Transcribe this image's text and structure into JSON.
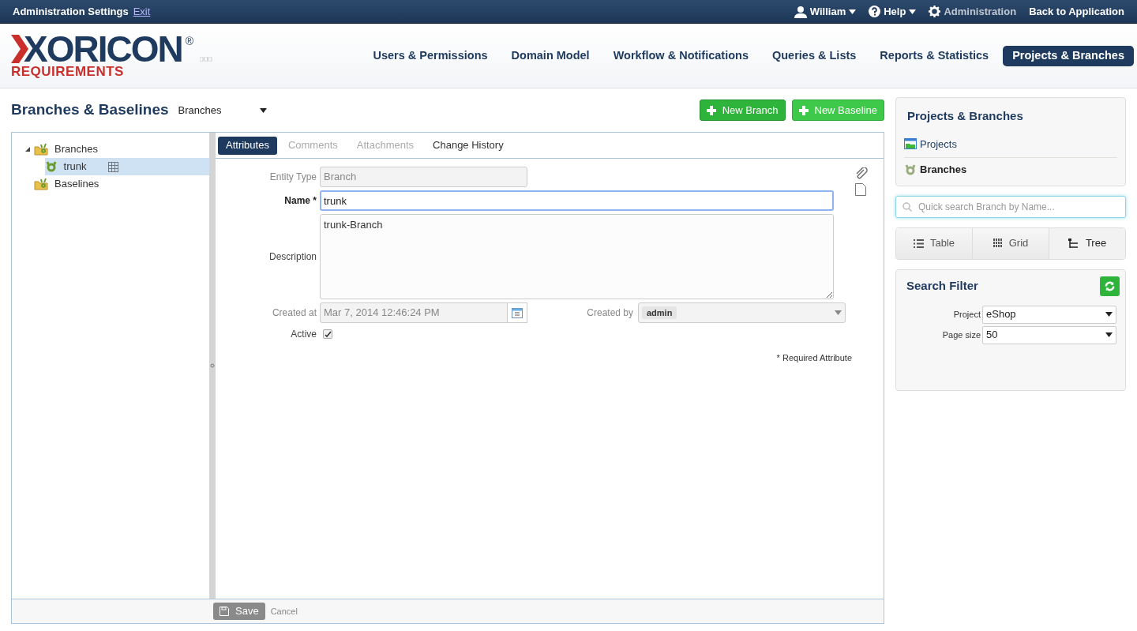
{
  "top_bar": {
    "title": "Administration Settings",
    "exit_link": "Exit",
    "user_menu": "William",
    "help_menu": "Help",
    "admin_label": "Administration",
    "back_link": "Back to Application"
  },
  "logo": {
    "name": "XORICON",
    "mark": "®",
    "subtitle": "REQUIREMENTS"
  },
  "main_nav": [
    {
      "label": "Users & Permissions",
      "selected": false
    },
    {
      "label": "Domain Model",
      "selected": false
    },
    {
      "label": "Workflow & Notifications",
      "selected": false
    },
    {
      "label": "Queries & Lists",
      "selected": false
    },
    {
      "label": "Reports & Statistics",
      "selected": false
    },
    {
      "label": "Projects & Branches",
      "selected": true
    }
  ],
  "page": {
    "title": "Branches & Baselines",
    "type_select": "Branches",
    "new_branch_button": "New Branch",
    "new_baseline_button": "New Baseline"
  },
  "tree": [
    {
      "label": "Branches",
      "kind": "folder",
      "expanded": true,
      "selected": false,
      "children": [
        {
          "label": "trunk",
          "kind": "branch",
          "selected": true
        }
      ]
    },
    {
      "label": "Baselines",
      "kind": "folder",
      "selected": false
    }
  ],
  "detail_tabs": [
    {
      "label": "Attributes",
      "selected": true,
      "disabled": false
    },
    {
      "label": "Comments",
      "selected": false,
      "disabled": true
    },
    {
      "label": "Attachments",
      "selected": false,
      "disabled": true
    },
    {
      "label": "Change History",
      "selected": false,
      "disabled": false
    }
  ],
  "form": {
    "entity_type_label": "Entity Type",
    "entity_type_value": "Branch",
    "name_label": "Name",
    "required_mark": "*",
    "name_value": "trunk",
    "description_label": "Description",
    "description_value": "trunk-Branch",
    "created_at_label": "Created at",
    "created_at_value": "Mar 7, 2014 12:46:24 PM",
    "created_by_label": "Created by",
    "created_by_value": "admin",
    "active_label": "Active",
    "active_checked": true,
    "required_note": "* Required Attribute"
  },
  "footer": {
    "save_button": "Save",
    "save_disabled": true,
    "cancel_link": "Cancel"
  },
  "sidebar": {
    "title": "Projects & Branches",
    "items": [
      {
        "label": "Projects",
        "kind": "projects",
        "selected": false
      },
      {
        "label": "Branches",
        "kind": "branches",
        "selected": true
      }
    ],
    "search_placeholder": "Quick search Branch by Name...",
    "views": [
      {
        "label": "Table",
        "kind": "table",
        "selected": false
      },
      {
        "label": "Grid",
        "kind": "grid",
        "selected": false
      },
      {
        "label": "Tree",
        "kind": "tree",
        "selected": true
      }
    ],
    "filter": {
      "title": "Search Filter",
      "project_label": "Project",
      "project_value": "eShop",
      "page_size_label": "Page size",
      "page_size_value": "50"
    }
  }
}
